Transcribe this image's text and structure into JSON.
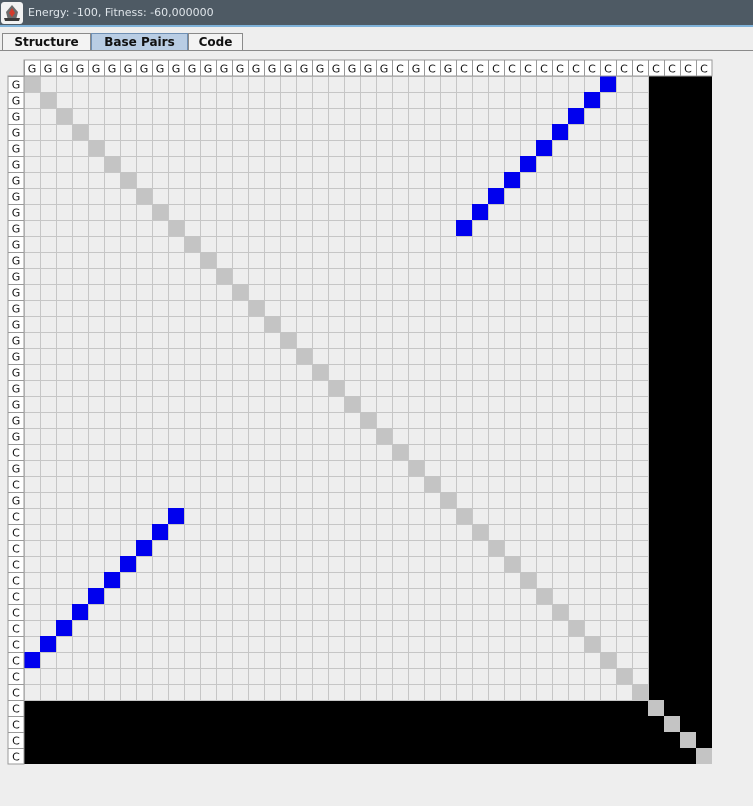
{
  "window": {
    "title": "Energy: -100, Fitness: -60,000000",
    "icon": "java-app-icon"
  },
  "tabs": [
    {
      "label": "Structure",
      "active": false
    },
    {
      "label": "Base Pairs",
      "active": true
    },
    {
      "label": "Code",
      "active": false
    }
  ],
  "matrix": {
    "column_sequence": [
      "G",
      "G",
      "G",
      "G",
      "G",
      "G",
      "G",
      "G",
      "G",
      "G",
      "G",
      "G",
      "G",
      "G",
      "G",
      "G",
      "G",
      "G",
      "G",
      "G",
      "G",
      "G",
      "G",
      "C",
      "G",
      "C",
      "G",
      "C",
      "C",
      "C",
      "C",
      "C",
      "C",
      "C",
      "C",
      "C",
      "C",
      "C",
      "C",
      "C",
      "C",
      "C",
      "C"
    ],
    "row_sequence": [
      "G",
      "G",
      "G",
      "G",
      "G",
      "G",
      "G",
      "G",
      "G",
      "G",
      "G",
      "G",
      "G",
      "G",
      "G",
      "G",
      "G",
      "G",
      "G",
      "G",
      "G",
      "G",
      "G",
      "C",
      "G",
      "C",
      "G",
      "C",
      "C",
      "C",
      "C",
      "C",
      "C",
      "C",
      "C",
      "C",
      "C",
      "C",
      "C",
      "C",
      "C",
      "C",
      "C"
    ],
    "colors": {
      "background": "#eeeeee",
      "grid_line": "#c6c6c6",
      "diagonal": "#c4c4c4",
      "pair": "#0000ee",
      "masked": "#000000"
    },
    "visible_range": {
      "start": 0,
      "end": 38
    },
    "base_pairs": [
      [
        0,
        36
      ],
      [
        1,
        35
      ],
      [
        2,
        34
      ],
      [
        3,
        33
      ],
      [
        4,
        32
      ],
      [
        5,
        31
      ],
      [
        6,
        30
      ],
      [
        7,
        29
      ],
      [
        8,
        28
      ],
      [
        9,
        27
      ]
    ]
  }
}
